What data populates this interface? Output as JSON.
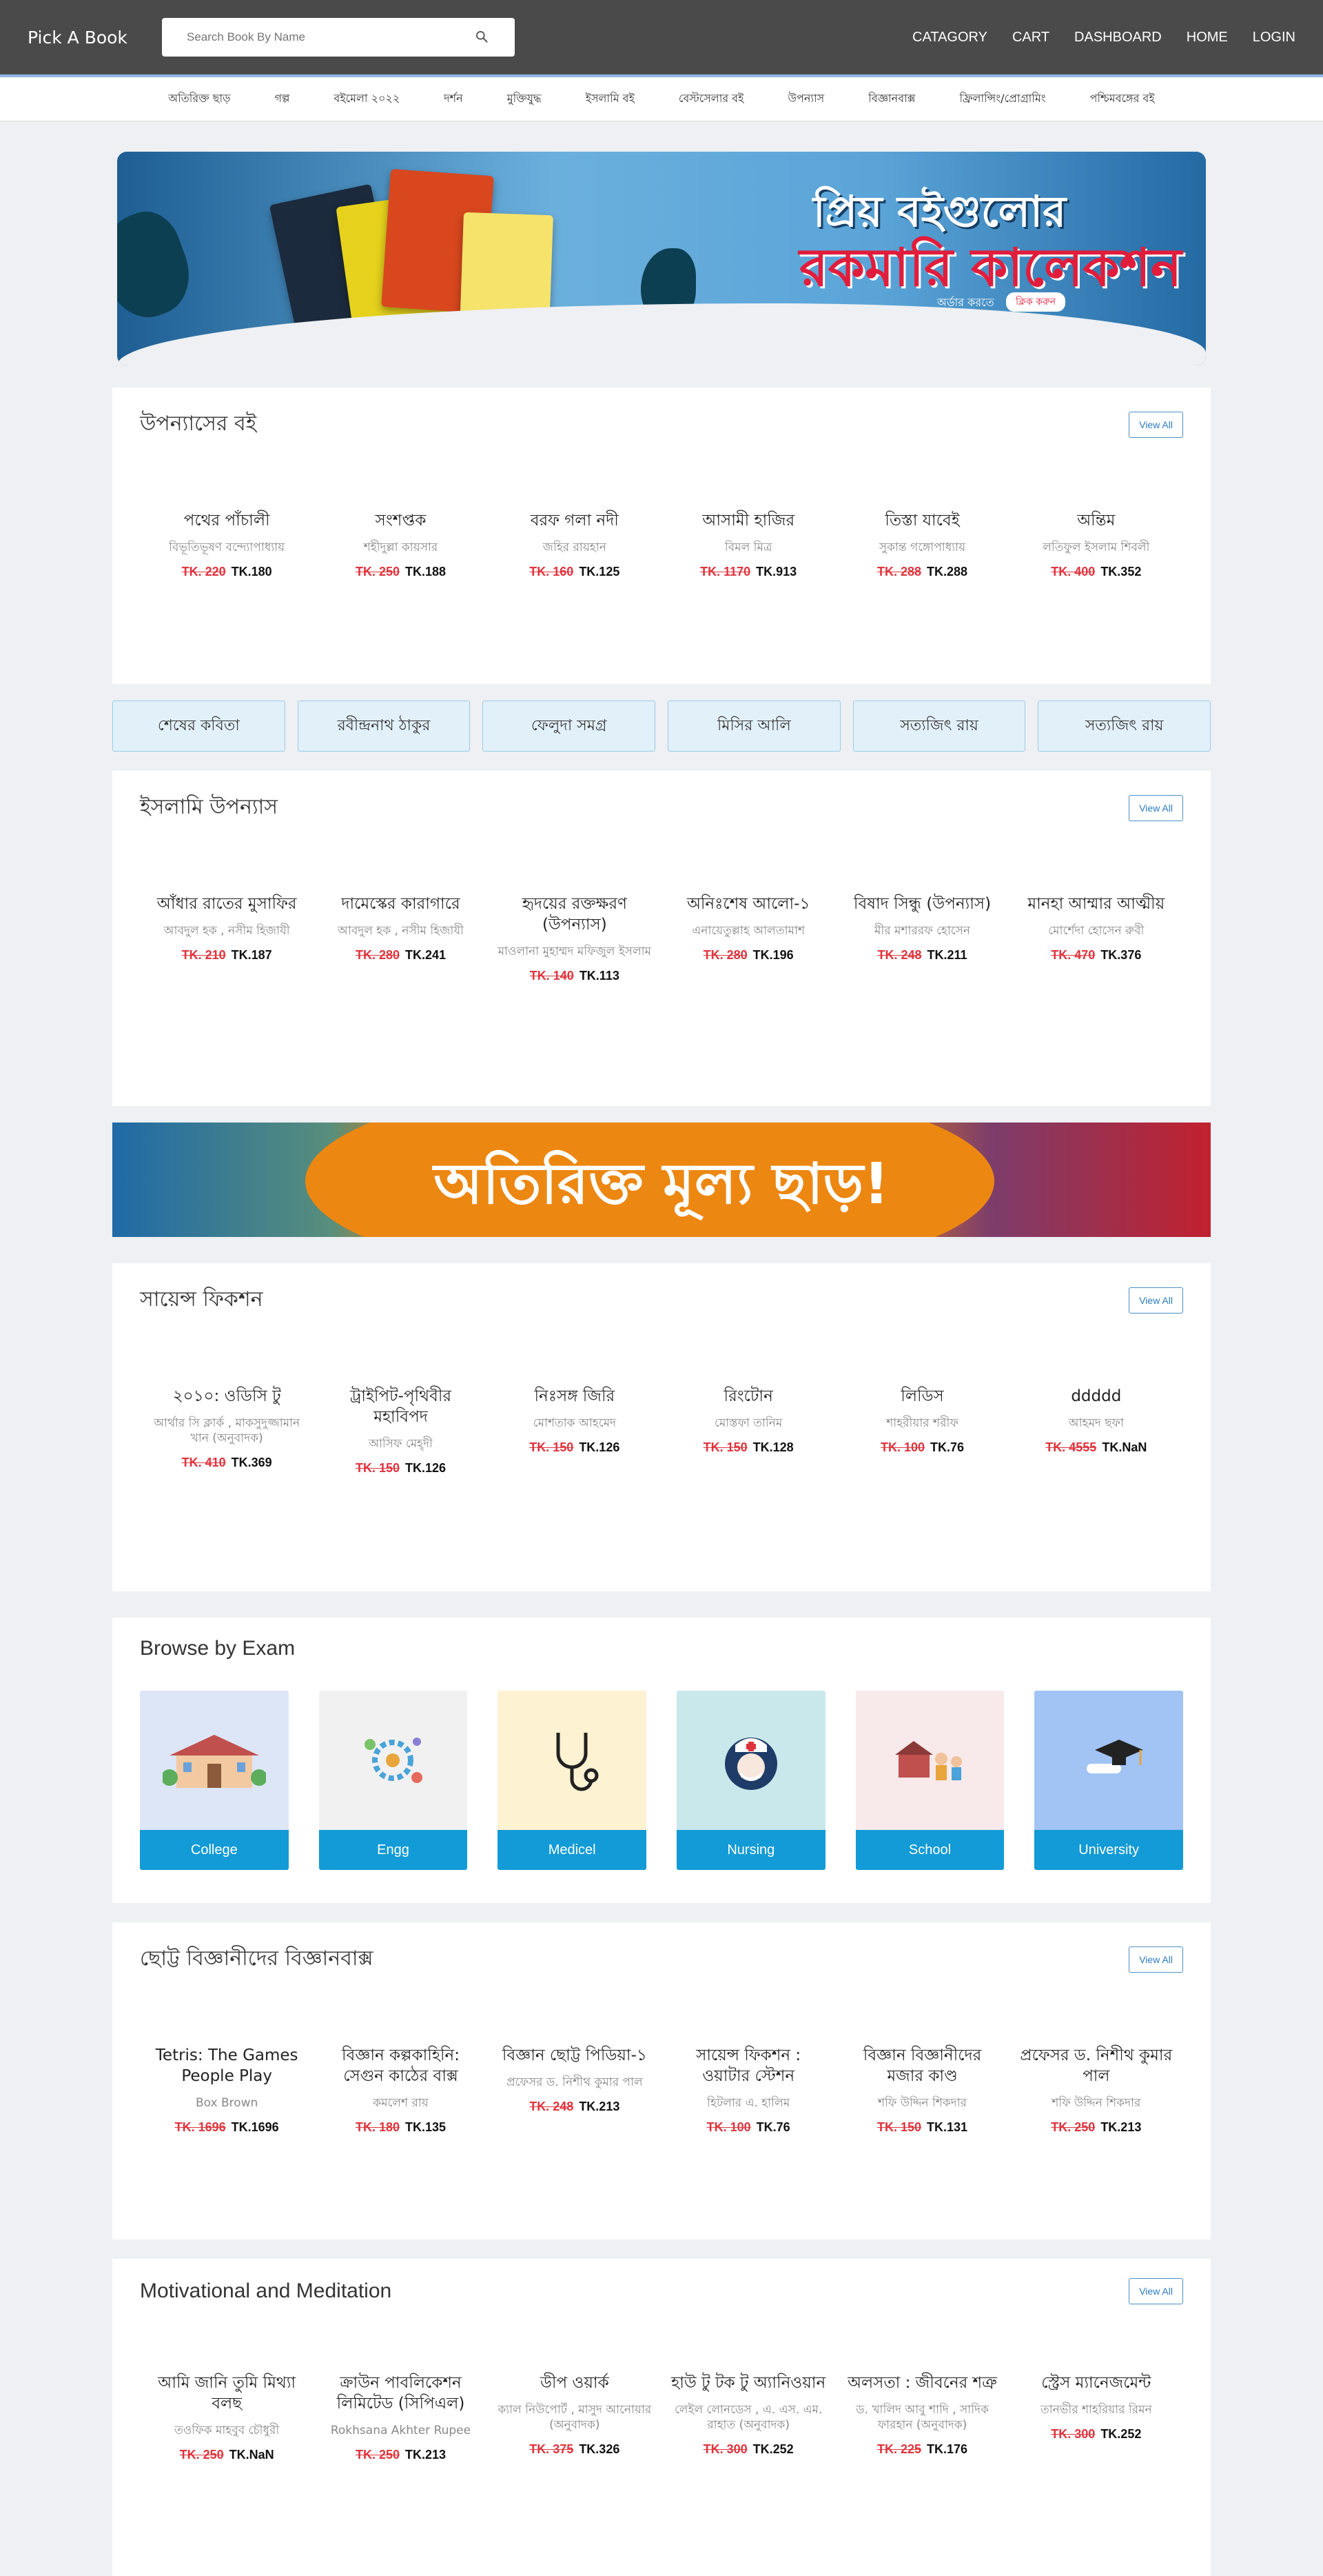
{
  "header": {
    "brand": "Pick A Book",
    "search_placeholder": "Search Book By Name",
    "nav": [
      "CATAGORY",
      "CART",
      "DASHBOARD",
      "HOME",
      "LOGIN"
    ]
  },
  "categories": [
    "অতিরিক্ত ছাড়",
    "গল্প",
    "বইমেলা ২০২২",
    "দর্শন",
    "মুক্তিযুদ্ধ",
    "ইসলামি বই",
    "বেস্টসেলার বই",
    "উপন্যাস",
    "বিজ্ঞানবাক্স",
    "ফ্রিলান্সিং/প্রোগ্রামিং",
    "পশ্চিমবঙ্গের বই"
  ],
  "banner": {
    "title_line1": "প্রিয় বইগুলোর",
    "title_line2": "রকমারি কালেকশন",
    "subtitle": "অর্ডার করতে",
    "cta": "ক্লিক করুন"
  },
  "sections": [
    {
      "title": "উপন্যাসের বই",
      "view_all": "View All",
      "books": [
        {
          "title": "পথের পাঁচালী",
          "author": "বিভূতিভূষণ বন্দ্যোপাধ্যায়",
          "old_price": "TK. 220",
          "new_price": "TK.180"
        },
        {
          "title": "সংশপ্তক",
          "author": "শহীদুল্লা কায়সার",
          "old_price": "TK. 250",
          "new_price": "TK.188"
        },
        {
          "title": "বরফ গলা নদী",
          "author": "জহির রায়হান",
          "old_price": "TK. 160",
          "new_price": "TK.125"
        },
        {
          "title": "আসামী হাজির",
          "author": "বিমল মিত্র",
          "old_price": "TK. 1170",
          "new_price": "TK.913"
        },
        {
          "title": "তিস্তা যাবেই",
          "author": "সুকান্ত গঙ্গোপাধ্যায়",
          "old_price": "TK. 288",
          "new_price": "TK.288"
        },
        {
          "title": "অন্তিম",
          "author": "লতিফুল ইসলাম শিবলী",
          "old_price": "TK. 400",
          "new_price": "TK.352"
        }
      ]
    },
    {
      "title": "ইসলামি উপন্যাস",
      "view_all": "View All",
      "books": [
        {
          "title": "আঁধার রাতের মুসাফির",
          "author": "আবদুল হক , নসীম হিজাযী",
          "old_price": "TK. 210",
          "new_price": "TK.187"
        },
        {
          "title": "দামেস্কের কারাগারে",
          "author": "আবদুল হক , নসীম হিজাযী",
          "old_price": "TK. 280",
          "new_price": "TK.241"
        },
        {
          "title": "হৃদয়ের রক্তক্ষরণ (উপন্যাস)",
          "author": "মাওলানা মুহাম্মদ মফিজুল ইসলাম",
          "old_price": "TK. 140",
          "new_price": "TK.113"
        },
        {
          "title": "অনিঃশেষ আলো-১",
          "author": "এনায়েতুল্লাহ আলতামাশ",
          "old_price": "TK. 280",
          "new_price": "TK.196"
        },
        {
          "title": "বিষাদ সিন্ধু (উপন্যাস)",
          "author": "মীর মশাররফ হোসেন",
          "old_price": "TK. 248",
          "new_price": "TK.211"
        },
        {
          "title": "মানহা আম্মার আত্মীয়",
          "author": "মোর্শেদা হোসেন রুবী",
          "old_price": "TK. 470",
          "new_price": "TK.376"
        }
      ]
    },
    {
      "title": "সায়েন্স ফিকশন",
      "view_all": "View All",
      "books": [
        {
          "title": "২০১০: ওডিসি টু",
          "author": "আর্থার সি ক্লার্ক , মাকসুদুজ্জামান খান (অনুবাদক)",
          "old_price": "TK. 410",
          "new_price": "TK.369"
        },
        {
          "title": "ট্রাইপিট-পৃথিবীর মহাবিপদ",
          "author": "আসিফ মেহ্দী",
          "old_price": "TK. 150",
          "new_price": "TK.126"
        },
        {
          "title": "নিঃসঙ্গ জিরি",
          "author": "মোশতাক আহমেদ",
          "old_price": "TK. 150",
          "new_price": "TK.126"
        },
        {
          "title": "রিংটোন",
          "author": "মোস্তফা তানিম",
          "old_price": "TK. 150",
          "new_price": "TK.128"
        },
        {
          "title": "লিডিস",
          "author": "শাহরীয়ার শরীফ",
          "old_price": "TK. 100",
          "new_price": "TK.76"
        },
        {
          "title": "ddddd",
          "author": "আহমদ ছফা",
          "old_price": "TK. 4555",
          "new_price": "TK.NaN"
        }
      ]
    },
    {
      "title": "ছোট্ট বিজ্ঞানীদের বিজ্ঞানবাক্স",
      "view_all": "View All",
      "books": [
        {
          "title": "Tetris: The Games People Play",
          "author": "Box Brown",
          "old_price": "TK. 1696",
          "new_price": "TK.1696"
        },
        {
          "title": "বিজ্ঞান কল্পকাহিনি: সেগুন কাঠের বাক্স",
          "author": "কমলেশ রায়",
          "old_price": "TK. 180",
          "new_price": "TK.135"
        },
        {
          "title": "বিজ্ঞান ছোট্ট পিডিয়া-১",
          "author": "প্রফেসর ড. নিশীথ কুমার পাল",
          "old_price": "TK. 248",
          "new_price": "TK.213"
        },
        {
          "title": "সায়েন্স ফিকশন : ওয়াটার স্টেশন",
          "author": "হিটলার এ. হালিম",
          "old_price": "TK. 100",
          "new_price": "TK.76"
        },
        {
          "title": "বিজ্ঞান বিজ্ঞানীদের মজার কাণ্ড",
          "author": "শফি উদ্দিন শিকদার",
          "old_price": "TK. 150",
          "new_price": "TK.131"
        },
        {
          "title": "প্রফেসর ড. নিশীথ কুমার পাল",
          "author": "শফি উদ্দিন শিকদার",
          "old_price": "TK. 250",
          "new_price": "TK.213"
        }
      ]
    },
    {
      "title": "Motivational and Meditation",
      "view_all": "View All",
      "books": [
        {
          "title": "আমি জানি তুমি মিথ্যা বলছ",
          "author": "তওফিক মাহবুব চৌধুরী",
          "old_price": "TK. 250",
          "new_price": "TK.NaN"
        },
        {
          "title": "ক্রাউন পাবলিকেশন লিমিটেড (সিপিএল)",
          "author": "Rokhsana Akhter Rupee",
          "old_price": "TK. 250",
          "new_price": "TK.213"
        },
        {
          "title": "ডীপ ওয়ার্ক",
          "author": "ক্যাল নিউপোর্ট , মাসুদ আনোয়ার (অনুবাদক)",
          "old_price": "TK. 375",
          "new_price": "TK.326"
        },
        {
          "title": "হাউ টু টক টু অ্যানিওয়ান",
          "author": "লেইল লোনডেস , এ. এস. এম. রাহাত (অনুবাদক)",
          "old_price": "TK. 300",
          "new_price": "TK.252"
        },
        {
          "title": "অলসতা : জীবনের শত্রু",
          "author": "ড. খালিদ আবু শাদি , সাদিক ফারহান (অনুবাদক)",
          "old_price": "TK. 225",
          "new_price": "TK.176"
        },
        {
          "title": "স্ট্রেস ম্যানেজমেন্ট",
          "author": "তানভীর শাহরিয়ার রিমন",
          "old_price": "TK. 300",
          "new_price": "TK.252"
        }
      ]
    }
  ],
  "writers": [
    "শেষের কবিতা",
    "রবীন্দ্রনাথ ঠাকুর",
    "ফেলুদা সমগ্র",
    "মিসির আলি",
    "সত্যজিৎ রায়",
    "সত্যজিৎ রায়"
  ],
  "promo": {
    "text": "অতিরিক্ত মূল্য ছাড়!"
  },
  "exams": {
    "title": "Browse by Exam",
    "items": [
      {
        "label": "College",
        "bg": "#dde6f6"
      },
      {
        "label": "Engg",
        "bg": "#f1f1f1"
      },
      {
        "label": "Medicel",
        "bg": "#fdf2d2"
      },
      {
        "label": "Nursing",
        "bg": "#c9e8ec"
      },
      {
        "label": "School",
        "bg": "#f8e9ea"
      },
      {
        "label": "University",
        "bg": "#a2c4f4"
      }
    ]
  }
}
